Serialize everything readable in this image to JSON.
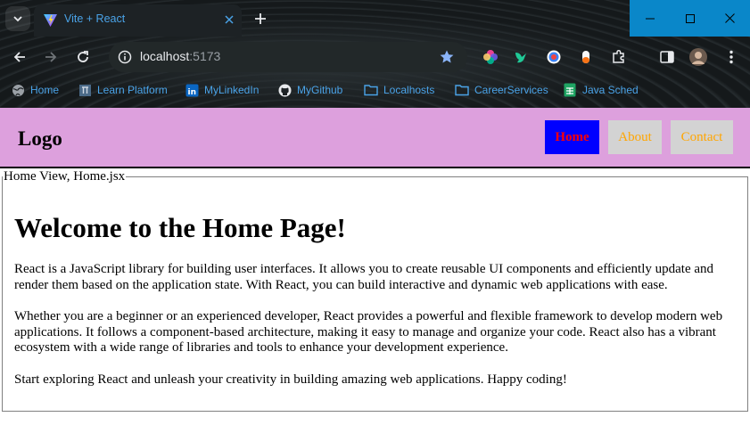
{
  "browser": {
    "tab_title": "Vite + React",
    "url_host": "localhost",
    "url_port": ":5173",
    "bookmarks": [
      {
        "label": "Home",
        "icon": "globe-icon"
      },
      {
        "label": "Learn Platform",
        "icon": "learn-platform-icon"
      },
      {
        "label": "MyLinkedIn",
        "icon": "linkedin-icon"
      },
      {
        "label": "MyGithub",
        "icon": "github-icon"
      },
      {
        "label": "Localhosts",
        "icon": "folder-icon"
      },
      {
        "label": "CareerServices",
        "icon": "folder-icon"
      },
      {
        "label": "Java Sched",
        "icon": "sheets-icon"
      }
    ]
  },
  "header": {
    "logo": "Logo",
    "nav": [
      {
        "label": "Home",
        "active": true
      },
      {
        "label": "About",
        "active": false
      },
      {
        "label": "Contact",
        "active": false
      }
    ]
  },
  "main": {
    "legend": "Home View, Home.jsx",
    "heading": "Welcome to the Home Page!",
    "paragraphs": [
      "React is a JavaScript library for building user interfaces. It allows you to create reusable UI components and efficiently update and render them based on the application state. With React, you can build interactive and dynamic web applications with ease.",
      "Whether you are a beginner or an experienced developer, React provides a powerful and flexible framework to develop modern web applications. It follows a component-based architecture, making it easy to manage and organize your code. React also has a vibrant ecosystem with a wide range of libraries and tools to enhance your development experience.",
      "Start exploring React and unleash your creativity in building amazing web applications. Happy coding!"
    ]
  },
  "colors": {
    "header_bg": "#dda0dd",
    "active_nav_bg": "#0000ff",
    "active_nav_text": "#ff0000",
    "nav_bg": "#d3d3d3",
    "nav_text": "#ffa500",
    "window_controls": "#0a87c9",
    "tab_text": "#4aa3e8"
  }
}
